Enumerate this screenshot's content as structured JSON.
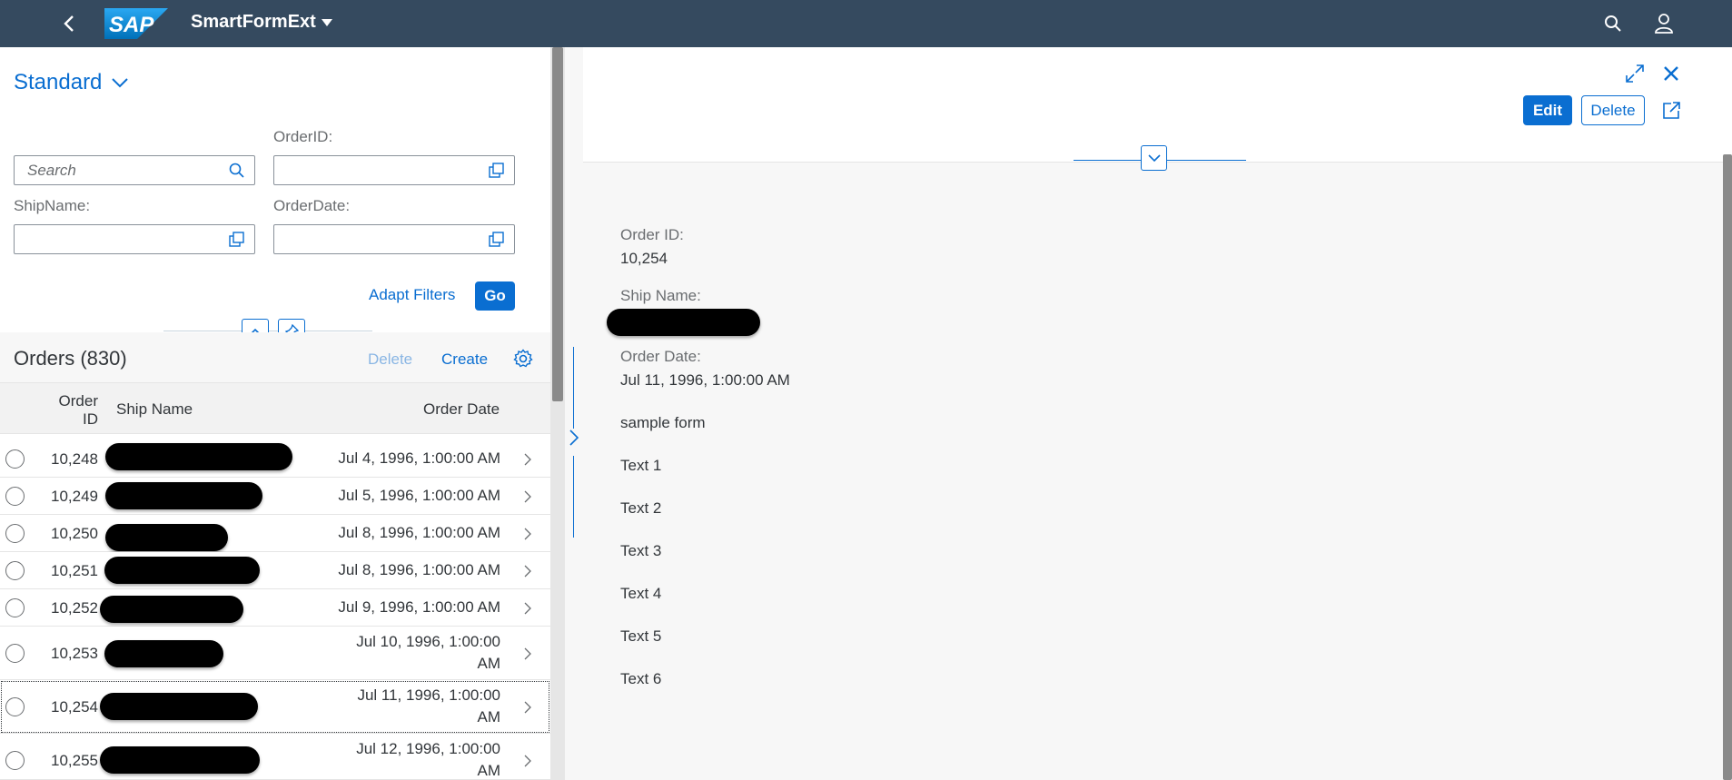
{
  "shell": {
    "logo_text": "SAP",
    "app_title": "SmartFormExt"
  },
  "filterbar": {
    "variant_name": "Standard",
    "search_placeholder": "Search",
    "order_id_label": "OrderID:",
    "ship_name_label": "ShipName:",
    "order_date_label": "OrderDate:",
    "adapt_filters_label": "Adapt Filters",
    "go_label": "Go"
  },
  "table": {
    "title": "Orders (830)",
    "delete_label": "Delete",
    "create_label": "Create",
    "columns": {
      "order_id_line1": "Order",
      "order_id_line2": "ID",
      "ship_name": "Ship Name",
      "order_date": "Order Date"
    },
    "rows": [
      {
        "id": "10,248",
        "date": "Jul 4, 1996, 1:00:00 AM"
      },
      {
        "id": "10,249",
        "date": "Jul 5, 1996, 1:00:00 AM"
      },
      {
        "id": "10,250",
        "date": "Jul 8, 1996, 1:00:00 AM"
      },
      {
        "id": "10,251",
        "date": "Jul 8, 1996, 1:00:00 AM"
      },
      {
        "id": "10,252",
        "date": "Jul 9, 1996, 1:00:00 AM"
      },
      {
        "id": "10,253",
        "date_line1": "Jul 10, 1996, 1:00:00",
        "date_line2": "AM"
      },
      {
        "id": "10,254",
        "date_line1": "Jul 11, 1996, 1:00:00",
        "date_line2": "AM"
      },
      {
        "id": "10,255",
        "date_line1": "Jul 12, 1996, 1:00:00",
        "date_line2": "AM"
      }
    ]
  },
  "detail": {
    "edit_label": "Edit",
    "delete_label": "Delete",
    "order_id_label": "Order ID:",
    "order_id_value": "10,254",
    "ship_name_label": "Ship Name:",
    "order_date_label": "Order Date:",
    "order_date_value": "Jul 11, 1996, 1:00:00 AM",
    "form_title": "sample form",
    "texts": [
      "Text 1",
      "Text 2",
      "Text 3",
      "Text 4",
      "Text 5",
      "Text 6"
    ]
  },
  "colors": {
    "shell": "#354a5f",
    "accent": "#0a6ed1"
  }
}
